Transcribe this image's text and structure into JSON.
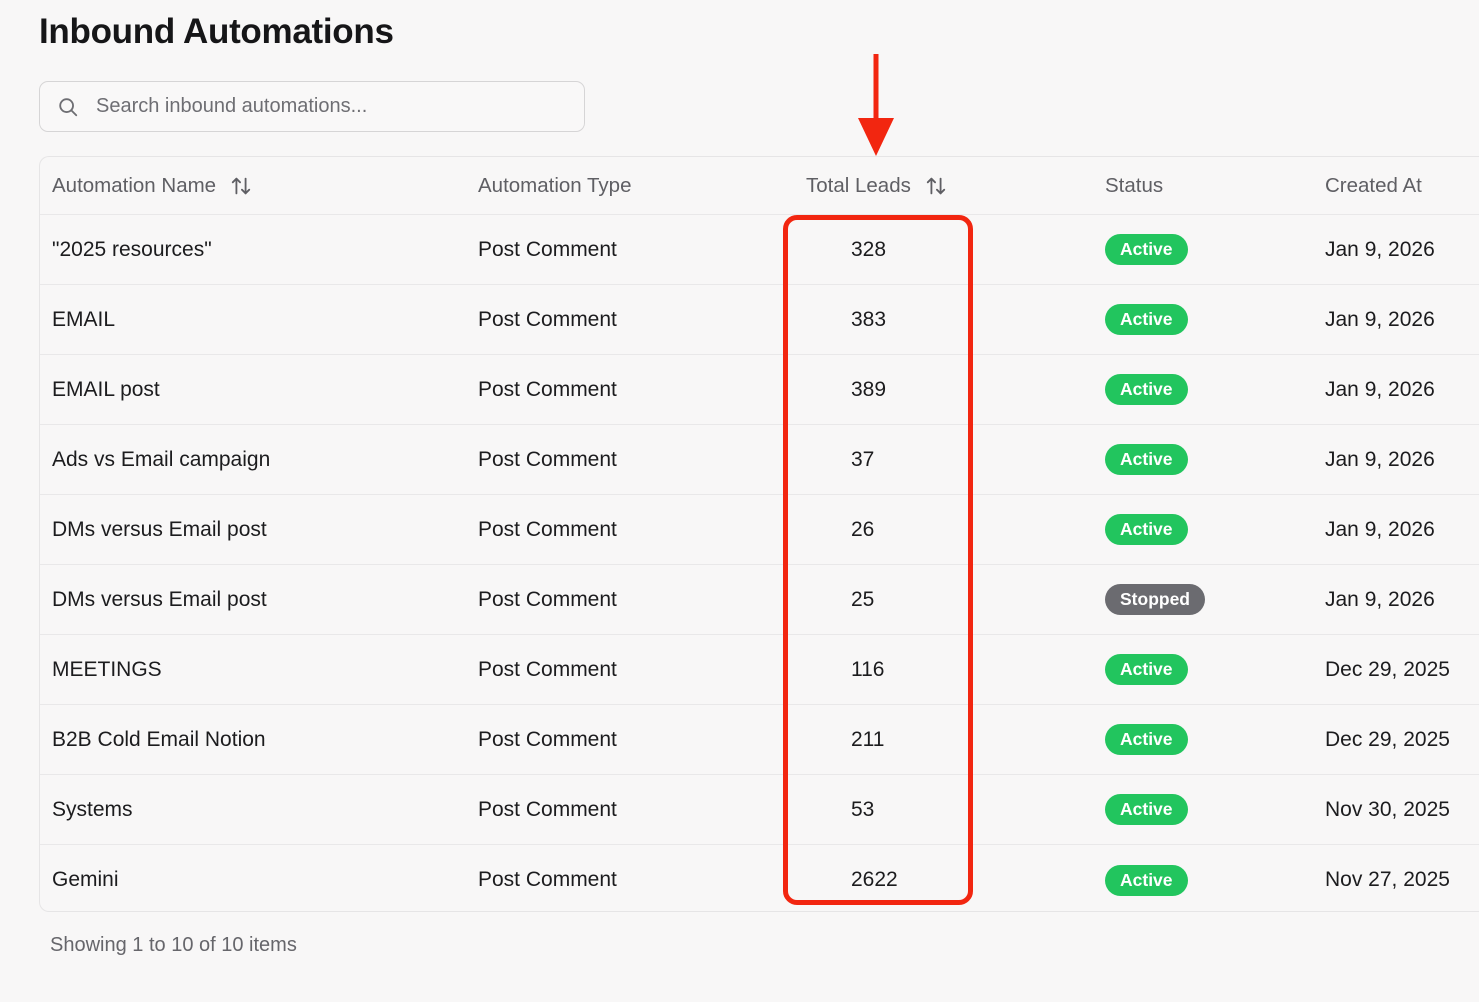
{
  "page": {
    "title": "Inbound Automations"
  },
  "search": {
    "placeholder": "Search inbound automations...",
    "icon": "search-icon"
  },
  "table": {
    "columns": [
      {
        "label": "Automation Name",
        "sortable": true
      },
      {
        "label": "Automation Type",
        "sortable": false
      },
      {
        "label": "Total Leads",
        "sortable": true
      },
      {
        "label": "Status",
        "sortable": false
      },
      {
        "label": "Created At",
        "sortable": false
      }
    ],
    "rows": [
      {
        "name": "\"2025 resources\"",
        "type": "Post Comment",
        "leads": "328",
        "status": "Active",
        "created": "Jan 9, 2026"
      },
      {
        "name": "EMAIL",
        "type": "Post Comment",
        "leads": "383",
        "status": "Active",
        "created": "Jan 9, 2026"
      },
      {
        "name": "EMAIL post",
        "type": "Post Comment",
        "leads": "389",
        "status": "Active",
        "created": "Jan 9, 2026"
      },
      {
        "name": "Ads vs Email campaign",
        "type": "Post Comment",
        "leads": "37",
        "status": "Active",
        "created": "Jan 9, 2026"
      },
      {
        "name": "DMs versus Email post",
        "type": "Post Comment",
        "leads": "26",
        "status": "Active",
        "created": "Jan 9, 2026"
      },
      {
        "name": "DMs versus Email post",
        "type": "Post Comment",
        "leads": "25",
        "status": "Stopped",
        "created": "Jan 9, 2026"
      },
      {
        "name": "MEETINGS",
        "type": "Post Comment",
        "leads": "116",
        "status": "Active",
        "created": "Dec 29, 2025"
      },
      {
        "name": "B2B Cold Email Notion",
        "type": "Post Comment",
        "leads": "211",
        "status": "Active",
        "created": "Dec 29, 2025"
      },
      {
        "name": "Systems",
        "type": "Post Comment",
        "leads": "53",
        "status": "Active",
        "created": "Nov 30, 2025"
      },
      {
        "name": "Gemini",
        "type": "Post Comment",
        "leads": "2622",
        "status": "Active",
        "created": "Nov 27, 2025"
      }
    ]
  },
  "footer": {
    "summary": "Showing 1 to 10 of 10 items"
  },
  "colors": {
    "active_badge": "#22c55e",
    "stopped_badge": "#6b6b70",
    "annotation": "#f22610"
  }
}
